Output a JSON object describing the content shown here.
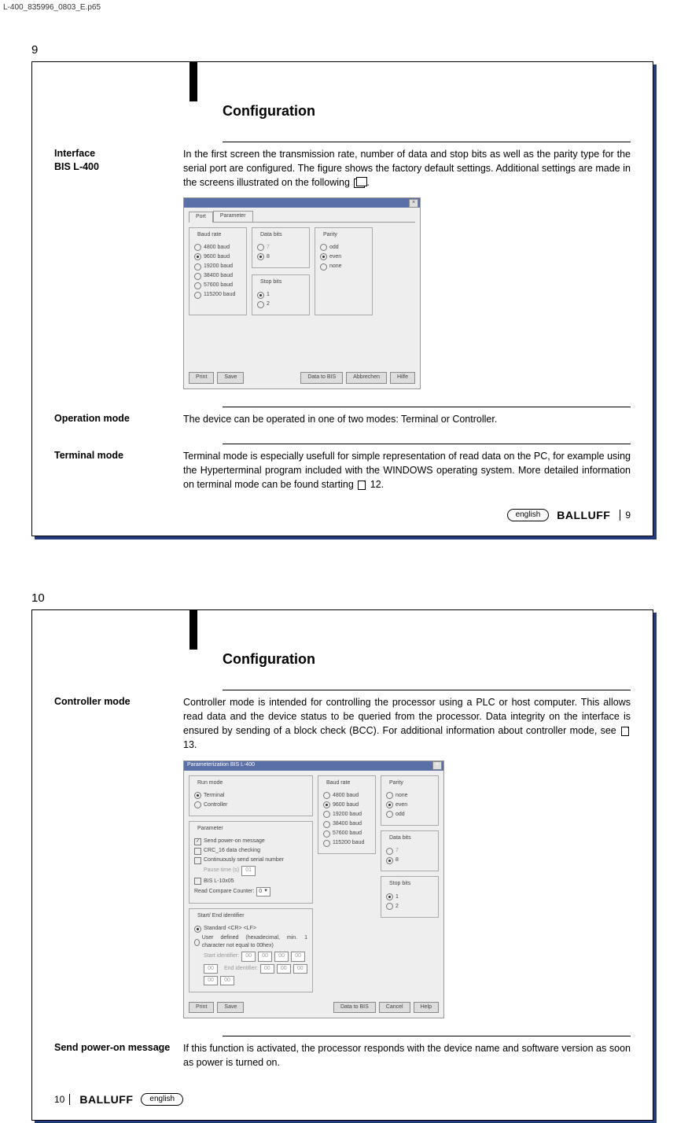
{
  "header_tag": "L-400_835996_0803_E.p65",
  "page9": {
    "number_top": "9",
    "title": "Configuration",
    "section1": {
      "label": "Interface\nBIS L-400",
      "text": "In the first screen the transmission rate, number of data and stop bits as well as the parity type for the serial port are configured. The figure shows the factory default settings. Additional settings are made in the screens illustrated on the following",
      "tail": "."
    },
    "fig1": {
      "tabs": [
        "Port",
        "Parameter"
      ],
      "groups": {
        "baud": {
          "legend": "Baud rate",
          "opts": [
            "4800 baud",
            "9600 baud",
            "19200 baud",
            "38400 baud",
            "57600 baud",
            "115200 baud"
          ],
          "sel": 1
        },
        "databits": {
          "legend": "Data bits",
          "opts": [
            "7",
            "8"
          ],
          "sel": 1
        },
        "stopbits": {
          "legend": "Stop bits",
          "opts": [
            "1",
            "2"
          ],
          "sel": 0
        },
        "parity": {
          "legend": "Parity",
          "opts": [
            "odd",
            "even",
            "none"
          ],
          "sel": 1
        }
      },
      "buttons": {
        "print": "Print",
        "save": "Save",
        "dtb": "Data to BIS",
        "abort": "Abbrechen",
        "help": "Hilfe"
      }
    },
    "section2": {
      "label": "Operation mode",
      "text": "The device can be operated in one of two modes: Terminal or Controller."
    },
    "section3": {
      "label": "Terminal mode",
      "text": "Terminal mode is especially usefull for simple representation of read data on the PC, for example using the Hyperterminal program included with the WINDOWS operating system. More detailed information on terminal mode can be found starting",
      "tail": " 12."
    },
    "footer": {
      "lang": "english",
      "brand": "BALLUFF",
      "page": "9"
    }
  },
  "page10": {
    "number_top": "10",
    "title": "Configuration",
    "section1": {
      "label": "Controller mode",
      "text": "Controller mode is intended for controlling the processor using a PLC or host computer. This allows read data and the device status to be queried from the processor. Data integrity on the interface is ensured by sending of a block check (BCC). For additional information about controller mode, see",
      "tail": " 13."
    },
    "fig2": {
      "title": "Parameterization BIS L-400",
      "runmode": {
        "legend": "Run mode",
        "opts": [
          "Terminal",
          "Controller"
        ],
        "sel": 0
      },
      "parameter": {
        "legend": "Parameter",
        "chks": [
          {
            "label": "Send power-on message",
            "sel": true
          },
          {
            "label": "CRC_16 data checking",
            "sel": false
          },
          {
            "label": "Continuously send serial number",
            "sel": false
          }
        ],
        "pausetime_label": "Pause time (s)",
        "pausetime_val": "01",
        "bis": {
          "label": "BIS L-10x05",
          "sel": false
        },
        "rcc_label": "Read Compare Counter:",
        "rcc_val": "0"
      },
      "startend": {
        "legend": "Start/ End identifier",
        "opts": [
          "Standard <CR> <LF>",
          "User defined (hexadecimal, min. 1 character not equal to 00hex)"
        ],
        "sel": 0,
        "start_label": "Start identifier:",
        "end_label": "End identifier:",
        "cells": [
          "00",
          "00",
          "00",
          "00",
          "00"
        ]
      },
      "baud": {
        "legend": "Baud rate",
        "opts": [
          "4800 baud",
          "9600 baud",
          "19200 baud",
          "38400 baud",
          "57600 baud",
          "115200 baud"
        ],
        "sel": 1
      },
      "parity": {
        "legend": "Parity",
        "opts": [
          "none",
          "even",
          "odd"
        ],
        "sel": 1
      },
      "databits": {
        "legend": "Data bits",
        "opts": [
          "7",
          "8"
        ],
        "sel": 1
      },
      "stopbits": {
        "legend": "Stop bits",
        "opts": [
          "1",
          "2"
        ],
        "sel": 0
      },
      "buttons": {
        "print": "Print",
        "save": "Save",
        "dtb": "Data to BIS",
        "cancel": "Cancel",
        "help": "Help"
      }
    },
    "section2": {
      "label": "Send power-on message",
      "text": "If this function is activated, the processor responds with the device name and software version as soon as power is turned on."
    },
    "footer": {
      "lang": "english",
      "brand": "BALLUFF",
      "page": "10"
    }
  }
}
